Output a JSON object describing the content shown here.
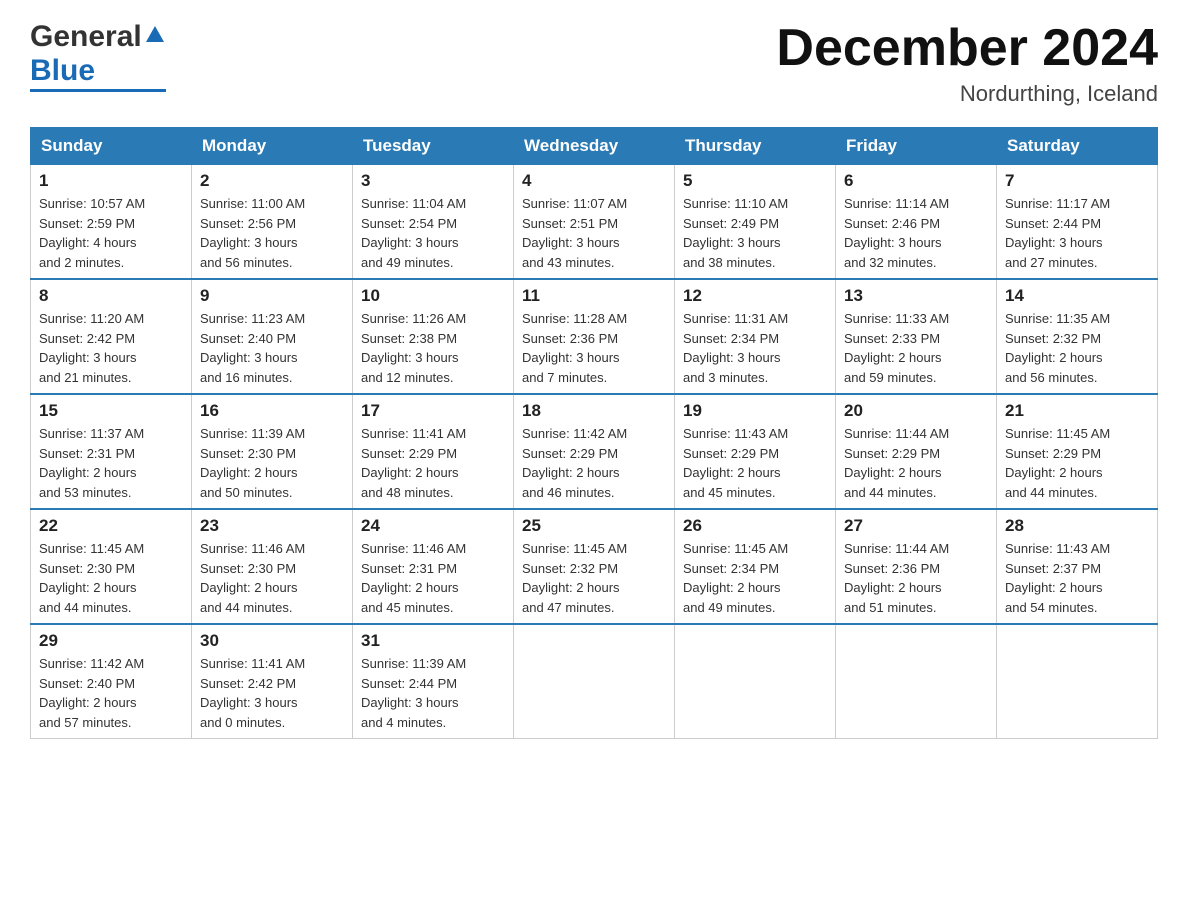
{
  "header": {
    "logo_general": "General",
    "logo_blue": "Blue",
    "month_title": "December 2024",
    "location": "Nordurthing, Iceland"
  },
  "weekdays": [
    "Sunday",
    "Monday",
    "Tuesday",
    "Wednesday",
    "Thursday",
    "Friday",
    "Saturday"
  ],
  "weeks": [
    [
      {
        "day": "1",
        "info": "Sunrise: 10:57 AM\nSunset: 2:59 PM\nDaylight: 4 hours\nand 2 minutes."
      },
      {
        "day": "2",
        "info": "Sunrise: 11:00 AM\nSunset: 2:56 PM\nDaylight: 3 hours\nand 56 minutes."
      },
      {
        "day": "3",
        "info": "Sunrise: 11:04 AM\nSunset: 2:54 PM\nDaylight: 3 hours\nand 49 minutes."
      },
      {
        "day": "4",
        "info": "Sunrise: 11:07 AM\nSunset: 2:51 PM\nDaylight: 3 hours\nand 43 minutes."
      },
      {
        "day": "5",
        "info": "Sunrise: 11:10 AM\nSunset: 2:49 PM\nDaylight: 3 hours\nand 38 minutes."
      },
      {
        "day": "6",
        "info": "Sunrise: 11:14 AM\nSunset: 2:46 PM\nDaylight: 3 hours\nand 32 minutes."
      },
      {
        "day": "7",
        "info": "Sunrise: 11:17 AM\nSunset: 2:44 PM\nDaylight: 3 hours\nand 27 minutes."
      }
    ],
    [
      {
        "day": "8",
        "info": "Sunrise: 11:20 AM\nSunset: 2:42 PM\nDaylight: 3 hours\nand 21 minutes."
      },
      {
        "day": "9",
        "info": "Sunrise: 11:23 AM\nSunset: 2:40 PM\nDaylight: 3 hours\nand 16 minutes."
      },
      {
        "day": "10",
        "info": "Sunrise: 11:26 AM\nSunset: 2:38 PM\nDaylight: 3 hours\nand 12 minutes."
      },
      {
        "day": "11",
        "info": "Sunrise: 11:28 AM\nSunset: 2:36 PM\nDaylight: 3 hours\nand 7 minutes."
      },
      {
        "day": "12",
        "info": "Sunrise: 11:31 AM\nSunset: 2:34 PM\nDaylight: 3 hours\nand 3 minutes."
      },
      {
        "day": "13",
        "info": "Sunrise: 11:33 AM\nSunset: 2:33 PM\nDaylight: 2 hours\nand 59 minutes."
      },
      {
        "day": "14",
        "info": "Sunrise: 11:35 AM\nSunset: 2:32 PM\nDaylight: 2 hours\nand 56 minutes."
      }
    ],
    [
      {
        "day": "15",
        "info": "Sunrise: 11:37 AM\nSunset: 2:31 PM\nDaylight: 2 hours\nand 53 minutes."
      },
      {
        "day": "16",
        "info": "Sunrise: 11:39 AM\nSunset: 2:30 PM\nDaylight: 2 hours\nand 50 minutes."
      },
      {
        "day": "17",
        "info": "Sunrise: 11:41 AM\nSunset: 2:29 PM\nDaylight: 2 hours\nand 48 minutes."
      },
      {
        "day": "18",
        "info": "Sunrise: 11:42 AM\nSunset: 2:29 PM\nDaylight: 2 hours\nand 46 minutes."
      },
      {
        "day": "19",
        "info": "Sunrise: 11:43 AM\nSunset: 2:29 PM\nDaylight: 2 hours\nand 45 minutes."
      },
      {
        "day": "20",
        "info": "Sunrise: 11:44 AM\nSunset: 2:29 PM\nDaylight: 2 hours\nand 44 minutes."
      },
      {
        "day": "21",
        "info": "Sunrise: 11:45 AM\nSunset: 2:29 PM\nDaylight: 2 hours\nand 44 minutes."
      }
    ],
    [
      {
        "day": "22",
        "info": "Sunrise: 11:45 AM\nSunset: 2:30 PM\nDaylight: 2 hours\nand 44 minutes."
      },
      {
        "day": "23",
        "info": "Sunrise: 11:46 AM\nSunset: 2:30 PM\nDaylight: 2 hours\nand 44 minutes."
      },
      {
        "day": "24",
        "info": "Sunrise: 11:46 AM\nSunset: 2:31 PM\nDaylight: 2 hours\nand 45 minutes."
      },
      {
        "day": "25",
        "info": "Sunrise: 11:45 AM\nSunset: 2:32 PM\nDaylight: 2 hours\nand 47 minutes."
      },
      {
        "day": "26",
        "info": "Sunrise: 11:45 AM\nSunset: 2:34 PM\nDaylight: 2 hours\nand 49 minutes."
      },
      {
        "day": "27",
        "info": "Sunrise: 11:44 AM\nSunset: 2:36 PM\nDaylight: 2 hours\nand 51 minutes."
      },
      {
        "day": "28",
        "info": "Sunrise: 11:43 AM\nSunset: 2:37 PM\nDaylight: 2 hours\nand 54 minutes."
      }
    ],
    [
      {
        "day": "29",
        "info": "Sunrise: 11:42 AM\nSunset: 2:40 PM\nDaylight: 2 hours\nand 57 minutes."
      },
      {
        "day": "30",
        "info": "Sunrise: 11:41 AM\nSunset: 2:42 PM\nDaylight: 3 hours\nand 0 minutes."
      },
      {
        "day": "31",
        "info": "Sunrise: 11:39 AM\nSunset: 2:44 PM\nDaylight: 3 hours\nand 4 minutes."
      },
      {
        "day": "",
        "info": ""
      },
      {
        "day": "",
        "info": ""
      },
      {
        "day": "",
        "info": ""
      },
      {
        "day": "",
        "info": ""
      }
    ]
  ]
}
